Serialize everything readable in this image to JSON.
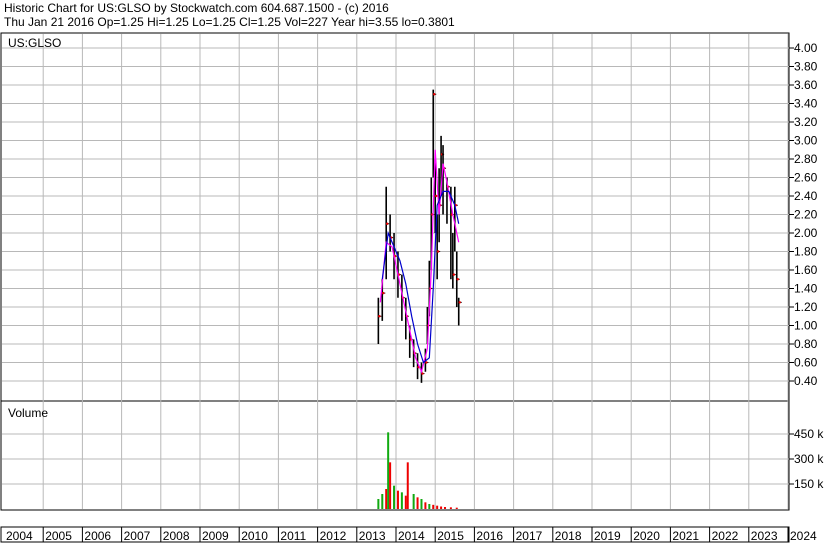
{
  "header": {
    "line1": "Historic Chart for US:GLSO by Stockwatch.com 604.687.1500 - (c) 2016",
    "line2": "Thu Jan 21 2016  Op=1.25  Hi=1.25  Lo=1.25  Cl=1.25  Vol=227  Year hi=3.55  lo=0.3801"
  },
  "colors": {
    "background": "#ffffff",
    "grid": "#b8b8b8",
    "price_bars": "#000000",
    "ma_short": "#ff00ff",
    "ma_long": "#0000cc",
    "volume_up": "#11aa11",
    "volume_down": "#ee0000",
    "markers": "#ee0000"
  },
  "chart_data": [
    {
      "type": "line",
      "panel": "price",
      "symbol_label": "US:GLSO",
      "ylim": [
        0.3,
        4.1
      ],
      "y_ticks": [
        "4.00",
        "3.80",
        "3.60",
        "3.40",
        "3.20",
        "3.00",
        "2.80",
        "2.60",
        "2.40",
        "2.20",
        "2.00",
        "1.80",
        "1.60",
        "1.40",
        "1.20",
        "1.00",
        "0.80",
        "0.60",
        "0.40"
      ],
      "x_ticks": [
        "2004",
        "2005",
        "2006",
        "2007",
        "2008",
        "2009",
        "2010",
        "2011",
        "2012",
        "2013",
        "2014",
        "2015",
        "2016",
        "2017",
        "2018",
        "2019",
        "2020",
        "2021",
        "2022",
        "2023",
        "2024"
      ],
      "grid": true,
      "price_series": {
        "x": [
          2013.55,
          2013.65,
          2013.75,
          2013.85,
          2013.95,
          2014.05,
          2014.15,
          2014.25,
          2014.35,
          2014.45,
          2014.55,
          2014.65,
          2014.75,
          2014.8,
          2014.85,
          2014.9,
          2014.95,
          2015.0,
          2015.05,
          2015.1,
          2015.15,
          2015.2,
          2015.3,
          2015.4,
          2015.45,
          2015.5,
          2015.55,
          2015.6
        ],
        "close": [
          1.1,
          1.35,
          2.1,
          1.95,
          1.75,
          1.55,
          1.3,
          1.1,
          0.85,
          0.7,
          0.55,
          0.48,
          0.6,
          1.0,
          1.4,
          2.2,
          3.5,
          2.4,
          1.8,
          2.3,
          2.85,
          2.7,
          2.5,
          2.2,
          1.55,
          2.3,
          1.5,
          1.25
        ],
        "high": [
          1.3,
          1.5,
          2.5,
          2.2,
          2.0,
          1.8,
          1.55,
          1.3,
          1.0,
          0.85,
          0.7,
          0.6,
          0.75,
          1.2,
          1.7,
          2.6,
          3.55,
          2.8,
          2.2,
          2.7,
          3.05,
          2.95,
          2.6,
          2.5,
          2.0,
          2.5,
          1.8,
          1.3
        ],
        "low": [
          0.8,
          1.05,
          1.5,
          1.8,
          1.5,
          1.3,
          1.05,
          0.85,
          0.65,
          0.55,
          0.42,
          0.38,
          0.5,
          0.8,
          1.1,
          1.6,
          2.6,
          2.0,
          1.5,
          1.9,
          2.4,
          2.2,
          2.1,
          1.5,
          1.4,
          1.8,
          1.2,
          1.0
        ]
      },
      "series": [
        {
          "x": [
            2013.6,
            2013.75,
            2013.9,
            2014.05,
            2014.2,
            2014.35,
            2014.5,
            2014.65,
            2014.8,
            2014.9,
            2015.0,
            2015.1,
            2015.2,
            2015.3,
            2015.45,
            2015.6
          ],
          "values": [
            1.25,
            1.9,
            1.85,
            1.55,
            1.25,
            0.95,
            0.65,
            0.5,
            0.75,
            1.6,
            2.9,
            2.2,
            2.75,
            2.55,
            2.2,
            1.9
          ]
        },
        {
          "x": [
            2013.65,
            2013.8,
            2013.95,
            2014.1,
            2014.25,
            2014.4,
            2014.55,
            2014.7,
            2014.85,
            2014.95,
            2015.05,
            2015.2,
            2015.35,
            2015.5,
            2015.6
          ],
          "values": [
            1.5,
            2.0,
            1.85,
            1.7,
            1.45,
            1.1,
            0.8,
            0.6,
            0.65,
            1.4,
            2.3,
            2.45,
            2.45,
            2.3,
            2.1
          ]
        }
      ]
    },
    {
      "type": "bar",
      "panel": "volume",
      "title": "Volume",
      "y_ticks": [
        "450 k",
        "300 k",
        "150 k"
      ],
      "ylim": [
        0,
        550000
      ],
      "x": [
        2013.55,
        2013.65,
        2013.75,
        2013.8,
        2013.85,
        2013.95,
        2014.05,
        2014.15,
        2014.25,
        2014.3,
        2014.45,
        2014.55,
        2014.65,
        2014.75,
        2014.85,
        2014.95,
        2015.05,
        2015.15,
        2015.25,
        2015.4,
        2015.55
      ],
      "values": [
        60000,
        90000,
        120000,
        460000,
        280000,
        140000,
        110000,
        100000,
        80000,
        280000,
        90000,
        70000,
        60000,
        40000,
        30000,
        25000,
        20000,
        15000,
        12000,
        10000,
        8000
      ],
      "up": [
        true,
        true,
        false,
        true,
        false,
        true,
        false,
        true,
        false,
        false,
        true,
        false,
        true,
        false,
        true,
        false,
        false,
        false,
        false,
        false,
        false
      ]
    }
  ]
}
